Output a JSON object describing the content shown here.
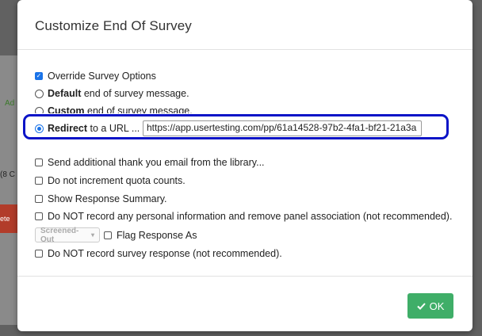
{
  "background": {
    "side_text_top": "Ad",
    "side_text_mid": "(8 C",
    "side_button": "ete"
  },
  "dialog": {
    "title": "Customize End Of Survey",
    "override_label": "Override Survey Options",
    "default_bold": "Default",
    "default_rest": " end of survey message.",
    "custom_bold": "Custom",
    "custom_rest": " end of survey message.",
    "redirect_bold": "Redirect",
    "redirect_rest": " to a URL ...",
    "redirect_url": "https://app.usertesting.com/pp/61a14528-97b2-4fa1-bf21-21a3a",
    "thank_you_label": "Send additional thank you email from the library...",
    "quota_label": "Do not increment quota counts.",
    "summary_label": "Show Response Summary.",
    "personal_info_label": "Do NOT record any personal information and remove panel association (not recommended).",
    "flag_dropdown_value": "Screened-Out",
    "flag_label": "Flag Response As",
    "no_record_label": "Do NOT record survey response (not recommended).",
    "ok_label": "OK"
  },
  "colors": {
    "accent_blue": "#1a73e8",
    "highlight_border": "#0b14c7",
    "ok_green": "#3fae68"
  },
  "icons": {
    "ok": "checkmark-icon",
    "dropdown": "caret-down-icon"
  }
}
